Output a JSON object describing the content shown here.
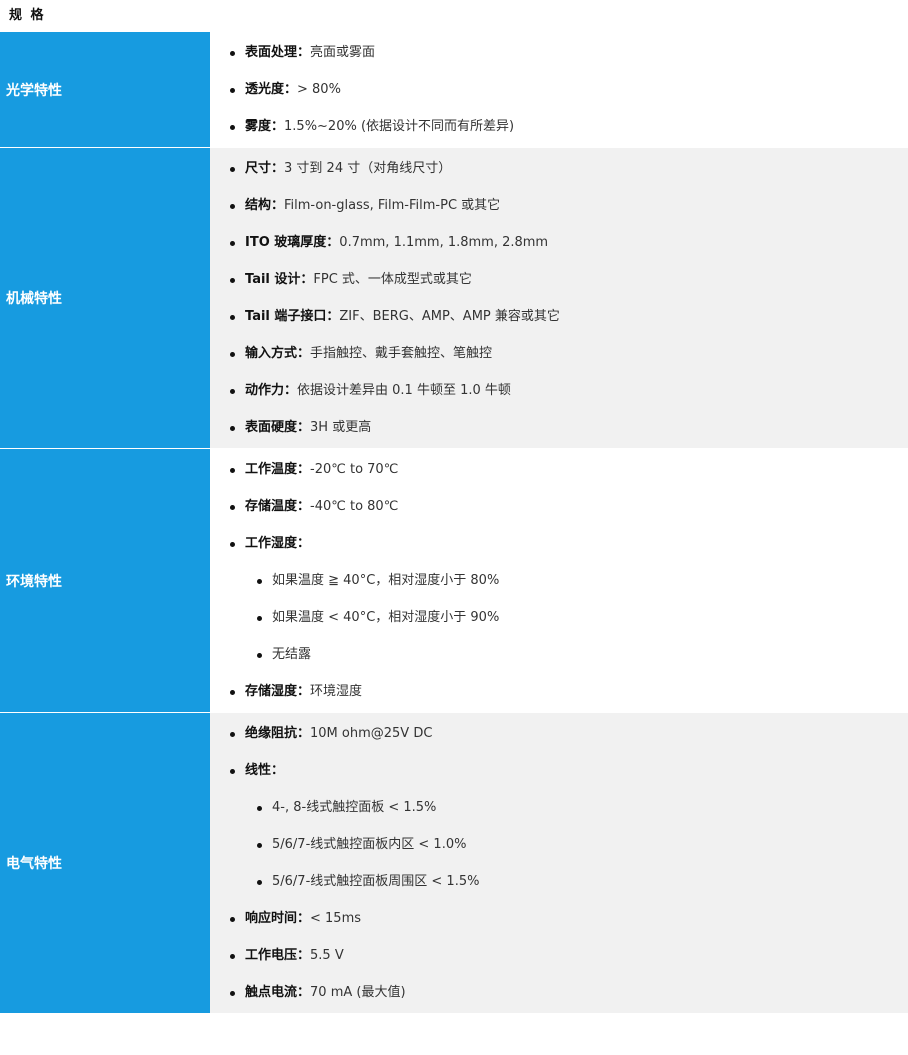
{
  "title": "规 格",
  "sections": [
    {
      "category": "光学特性",
      "items": [
        {
          "key": "表面处理：",
          "value": "亮面或雾面"
        },
        {
          "key": "透光度：",
          "value": "> 80%"
        },
        {
          "key": "雾度：",
          "value": "1.5%~20% (依据设计不同而有所差异)"
        }
      ]
    },
    {
      "category": "机械特性",
      "items": [
        {
          "key": "尺寸：",
          "value": "3 寸到 24 寸（对角线尺寸）"
        },
        {
          "key": "结构：",
          "value": "Film-on-glass, Film-Film-PC 或其它"
        },
        {
          "key": "ITO 玻璃厚度：",
          "value": "0.7mm, 1.1mm, 1.8mm, 2.8mm"
        },
        {
          "key": "Tail 设计：",
          "value": "FPC 式、一体成型式或其它"
        },
        {
          "key": "Tail 端子接口：",
          "value": "ZIF、BERG、AMP、AMP 兼容或其它"
        },
        {
          "key": "输入方式：",
          "value": "手指触控、戴手套触控、笔触控"
        },
        {
          "key": "动作力：",
          "value": "依据设计差异由 0.1 牛顿至 1.0 牛顿"
        },
        {
          "key": "表面硬度：",
          "value": "3H 或更高"
        }
      ]
    },
    {
      "category": "环境特性",
      "items": [
        {
          "key": "工作温度：",
          "value": "-20℃  to 70℃"
        },
        {
          "key": "存储温度：",
          "value": "-40℃  to 80℃"
        },
        {
          "key": "工作湿度：",
          "value": ""
        },
        {
          "key": "",
          "value": "如果温度 ≧ 40°C，相对湿度小于 80%",
          "sub": true
        },
        {
          "key": "",
          "value": "如果温度 < 40°C，相对湿度小于 90%",
          "sub": true
        },
        {
          "key": "",
          "value": "无结露",
          "sub": true
        },
        {
          "key": "存储湿度：",
          "value": "环境湿度"
        }
      ]
    },
    {
      "category": "电气特性",
      "items": [
        {
          "key": "绝缘阻抗：",
          "value": "10M ohm@25V DC"
        },
        {
          "key": "线性：",
          "value": ""
        },
        {
          "key": "",
          "value": "4-, 8-线式触控面板 < 1.5%",
          "sub": true
        },
        {
          "key": "",
          "value": "5/6/7-线式触控面板内区 < 1.0%",
          "sub": true
        },
        {
          "key": "",
          "value": "5/6/7-线式触控面板周围区 < 1.5%",
          "sub": true
        },
        {
          "key": "响应时间：",
          "value": "< 15ms"
        },
        {
          "key": "工作电压：",
          "value": "5.5 V"
        },
        {
          "key": "触点电流：",
          "value": "70 mA (最大值)"
        }
      ]
    }
  ]
}
